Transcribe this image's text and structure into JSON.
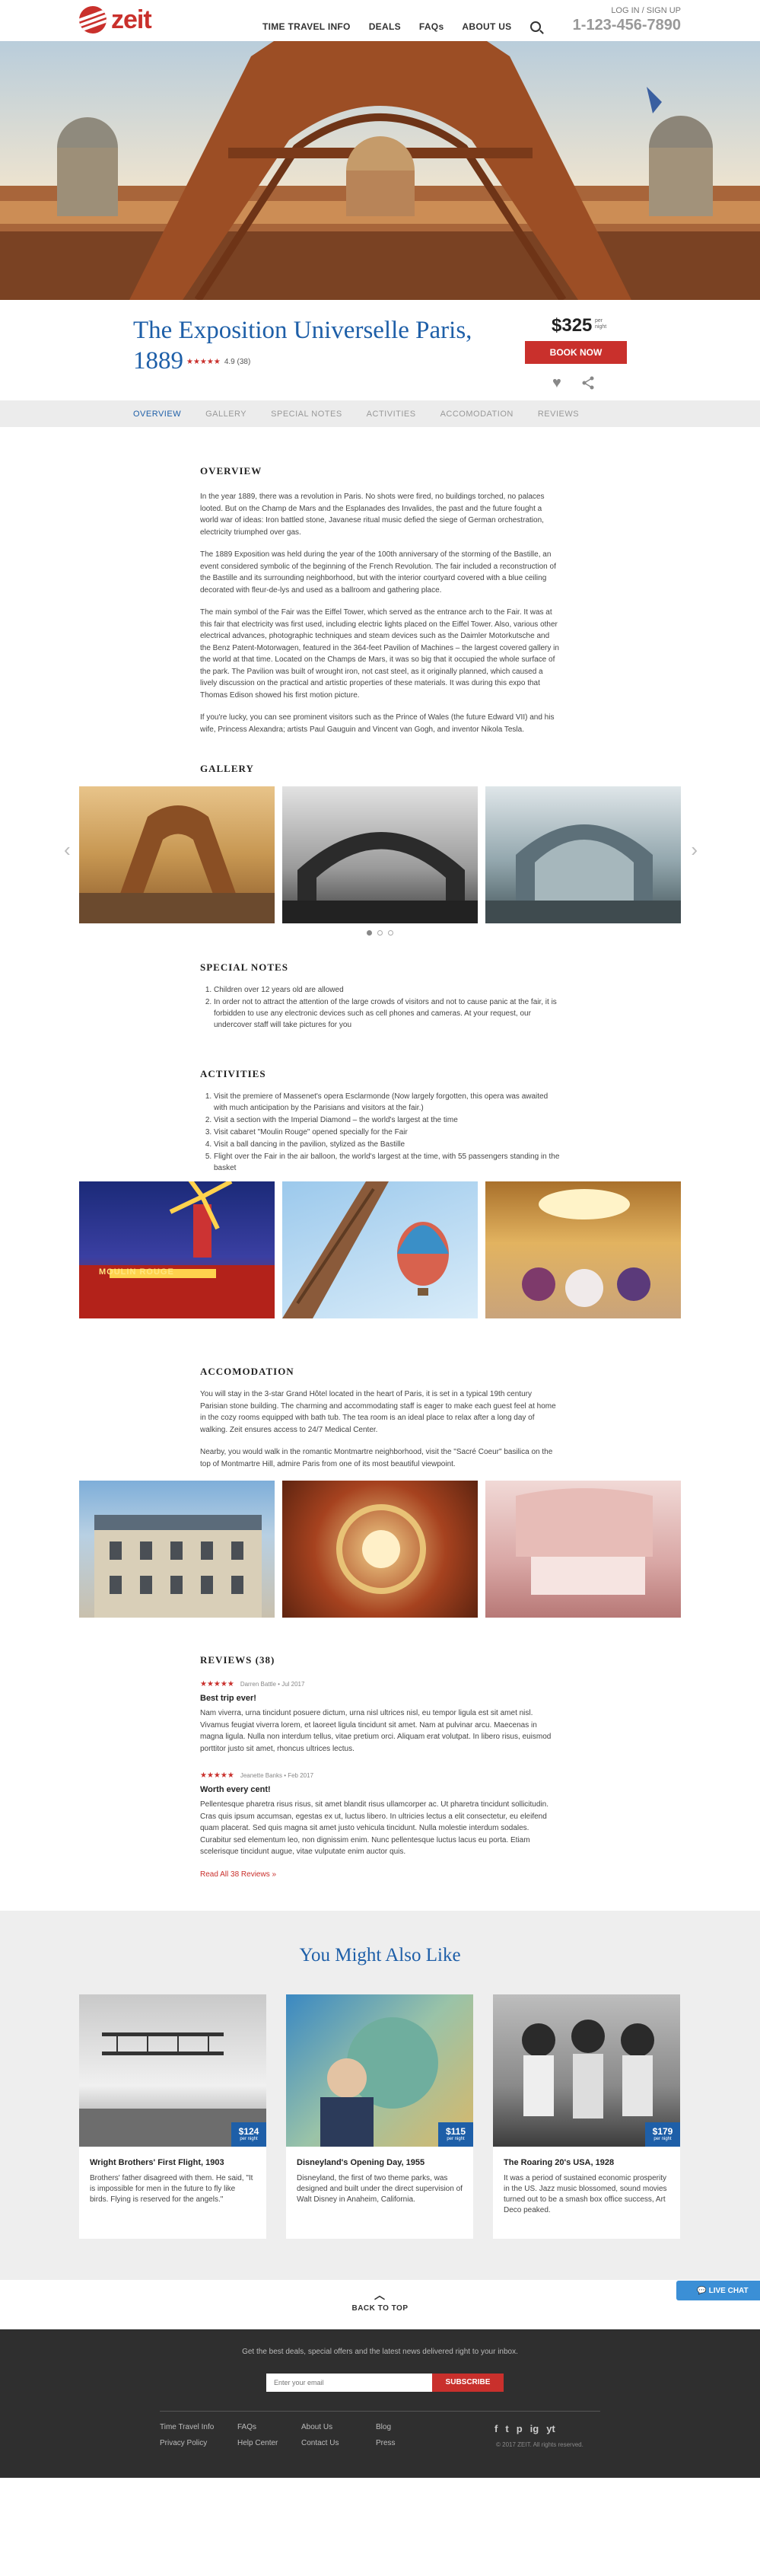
{
  "header": {
    "brand": "zeit",
    "nav": [
      "TIME TRAVEL INFO",
      "DEALS",
      "FAQs",
      "ABOUT US"
    ],
    "auth": "LOG IN / SIGN UP",
    "phone": "1-123-456-7890"
  },
  "tour": {
    "title": "The Exposition Universelle Paris, 1889",
    "rating_stars": "★★★★★",
    "rating_text": "4.9 (38)",
    "price": "$325",
    "price_per": "per night",
    "book_label": "BOOK NOW"
  },
  "tabs": [
    "OVERVIEW",
    "GALLERY",
    "SPECIAL NOTES",
    "ACTIVITIES",
    "ACCOMODATION",
    "REVIEWS"
  ],
  "overview": {
    "heading": "OVERVIEW",
    "paragraphs": [
      "In the year 1889, there was a revolution in Paris. No shots were fired, no buildings torched, no palaces looted. But on the Champ de Mars and the Esplanades des Invalides, the past and the future fought a world war of ideas: Iron battled stone, Javanese ritual music defied the siege of German orchestration, electricity triumphed over gas.",
      "The 1889 Exposition was held during the year of the 100th anniversary of the storming of the Bastille, an event considered symbolic of the beginning of the French Revolution. The fair included a reconstruction of the Bastille and its surrounding neighborhood, but with the interior courtyard covered with a blue ceiling decorated with fleur-de-lys and used as a ballroom and gathering place.",
      "The main symbol of the Fair was the Eiffel Tower, which served as the entrance arch to the Fair. It was at this fair that electricity was first used, including electric lights placed on the Eiffel Tower. Also, various other electrical advances, photographic techniques and steam devices such as the Daimler Motorkutsche and the Benz Patent-Motorwagen, featured in the 364-feet Pavilion of Machines – the largest covered gallery in the world at that time. Located on the Champs de Mars, it was so big that it occupied the whole surface of the park. The Pavilion was built of wrought iron, not cast steel, as it originally planned, which caused a lively discussion on the practical and artistic properties of these materials. It was during this expo that Thomas Edison showed his first motion picture.",
      "If you're lucky, you can see prominent visitors such as the Prince of Wales (the future Edward VII) and his wife, Princess Alexandra; artists Paul Gauguin and Vincent van Gogh, and inventor Nikola Tesla."
    ]
  },
  "gallery": {
    "heading": "GALLERY",
    "prev": "‹",
    "next": "›"
  },
  "special_notes": {
    "heading": "SPECIAL NOTES",
    "items": [
      "Children over 12 years old are allowed",
      "In order not to attract the attention of the large crowds of visitors and not to cause panic at the fair, it is forbidden to use any electronic devices such as cell phones and cameras. At your request, our undercover staff will take pictures for you"
    ]
  },
  "activities": {
    "heading": "ACTIVITIES",
    "items": [
      "Visit the premiere of Massenet's opera Esclarmonde (Now largely forgotten, this opera was awaited with much anticipation by the Parisians and visitors at the fair.)",
      "Visit a section with the Imperial Diamond – the world's largest at the time",
      "Visit cabaret \"Moulin Rouge\" opened specially for the Fair",
      "Visit a ball dancing in the pavilion, stylized as the Bastille",
      "Flight over the Fair in the air balloon, the world's largest at the time, with 55 passengers standing in the basket"
    ],
    "photo_sign": "MOULIN ROUGE"
  },
  "accomodation": {
    "heading": "ACCOMODATION",
    "paragraphs": [
      "You will stay in the 3-star Grand Hôtel located in the heart of Paris, it is set in a typical 19th century Parisian stone building. The charming and accommodating staff is eager to make each guest feel at home in the cozy rooms equipped with bath tub. The tea room is an ideal place to relax after a long day of walking. Zeit ensures access to 24/7 Medical Center.",
      "Nearby, you would walk in the romantic Montmartre neighborhood, visit the \"Sacré Coeur\" basilica on the top of Montmartre Hill, admire Paris from one of its most beautiful viewpoint."
    ]
  },
  "reviews": {
    "heading": "REVIEWS (38)",
    "items": [
      {
        "stars": "★★★★★",
        "author": "Darren Battle • Jul 2017",
        "title": "Best trip ever!",
        "text": "Nam viverra, urna tincidunt posuere dictum, urna nisl ultrices nisl, eu tempor ligula est sit amet nisl. Vivamus feugiat viverra lorem, et laoreet ligula tincidunt sit amet. Nam at pulvinar arcu. Maecenas in magna ligula. Nulla non interdum tellus, vitae pretium orci. Aliquam erat volutpat. In libero risus, euismod porttitor justo sit amet, rhoncus ultrices lectus."
      },
      {
        "stars": "★★★★★",
        "author": "Jeanette Banks • Feb 2017",
        "title": "Worth every cent!",
        "text": "Pellentesque pharetra risus risus, sit amet blandit risus ullamcorper ac. Ut pharetra tincidunt sollicitudin. Cras quis ipsum accumsan, egestas ex ut, luctus libero. In ultricies lectus a elit consectetur, eu eleifend quam placerat. Sed quis magna sit amet justo vehicula tincidunt. Nulla molestie interdum sodales. Curabitur sed elementum leo, non dignissim enim. Nunc pellentesque luctus lacus eu porta. Etiam scelerisque tincidunt augue, vitae vulputate enim auctor quis."
      }
    ],
    "read_all": "Read All 38 Reviews  »"
  },
  "also_like": {
    "heading": "You Might Also Like",
    "cards": [
      {
        "price": "$124",
        "per": "per night",
        "title": "Wright Brothers' First Flight, 1903",
        "text": "Brothers' father disagreed with them. He said, \"It is impossible for men in the future to fly like birds. Flying is reserved for the angels.\""
      },
      {
        "price": "$115",
        "per": "per night",
        "title": "Disneyland's Opening Day, 1955",
        "text": "Disneyland, the first of two theme parks, was designed and built under the direct supervision of Walt Disney in Anaheim, California."
      },
      {
        "price": "$179",
        "per": "per night",
        "title": "The Roaring 20's USA, 1928",
        "text": "It was a period of sustained economic prosperity in the US. Jazz music blossomed, sound movies turned out to be a smash box office success, Art Deco peaked."
      }
    ]
  },
  "back_to_top": "BACK TO TOP",
  "live_chat": "LIVE CHAT",
  "footer": {
    "tagline": "Get the best deals, special offers and the latest news delivered right to your inbox.",
    "email_placeholder": "Enter your email",
    "subscribe": "SUBSCRIBE",
    "links": [
      "Time Travel Info",
      "FAQs",
      "About Us",
      "Blog",
      "Privacy Policy",
      "Help Center",
      "Contact Us",
      "Press"
    ],
    "social": [
      "f",
      "t",
      "p",
      "ig",
      "yt"
    ],
    "copyright": "© 2017 ZEIT. All rights reserved."
  },
  "colors": {
    "brand_red": "#c9302c",
    "title_blue": "#1e5fa8"
  }
}
